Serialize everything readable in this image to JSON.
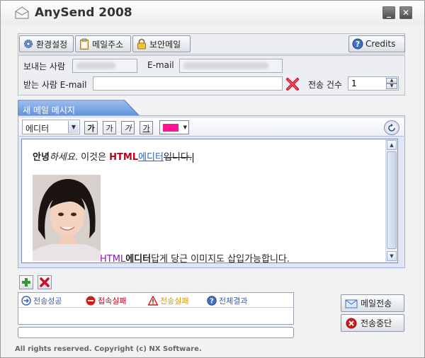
{
  "window": {
    "title": "AnySend 2008",
    "minimize_label": "_",
    "close_label": "✕"
  },
  "toolbar": {
    "settings_label": "환경설정",
    "addressbook_label": "메일주소",
    "secure_label": "보안메일",
    "credits_label": "Credits"
  },
  "sender": {
    "name_label": "보내는 사람",
    "email_label": "E-mail"
  },
  "recipient": {
    "email_label": "받는 사람 E-mail",
    "email_value": "",
    "count_label": "전송 건수",
    "count_value": "1"
  },
  "message_tab": {
    "label": "새 메일 메시지"
  },
  "editor": {
    "mode_value": "에디터",
    "format_bold": "가",
    "format_italic": "가",
    "format_strike": "가",
    "format_underline": "가",
    "text_color": "#ff1493",
    "line1": {
      "greeting": "안녕",
      "greeting2": "하세요",
      "mid": ". 이것은 ",
      "html": "HTML",
      "editor_word": "에디터",
      "tail": "입니다."
    },
    "line2": {
      "html": "HTML",
      "editor_word": "에디터",
      "rest": "답게 당근 이미지도 삽입가능합니다."
    }
  },
  "results": {
    "tab_success": "전송성공",
    "tab_conn_fail": "접속실패",
    "tab_send_fail": "전송실패",
    "tab_all": "전체결과"
  },
  "progress": {
    "percent": 0
  },
  "actions": {
    "send_label": "메일전송",
    "stop_label": "전송중단"
  },
  "footer": {
    "copyright": "All rights reserved. Copyright (c) NX Software."
  },
  "colors": {
    "accent_blue": "#2e62b8",
    "tab_blue": "#6d9be0",
    "red_text": "#c0001a",
    "purple_text": "#8a1fa8",
    "warning_orange": "#d79a00"
  }
}
